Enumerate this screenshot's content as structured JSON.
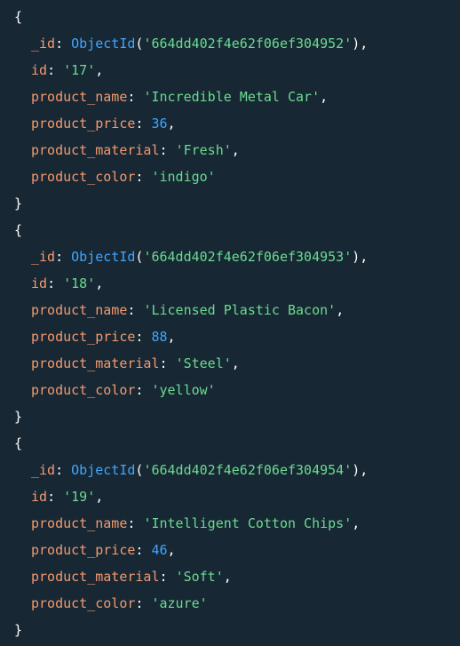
{
  "documents": [
    {
      "id_label": "_id",
      "objectid_fn": "ObjectId",
      "objectid_value": "'664dd402f4e62f06ef304952'",
      "fields": [
        {
          "key": "id",
          "value": "'17'",
          "type": "string"
        },
        {
          "key": "product_name",
          "value": "'Incredible Metal Car'",
          "type": "string"
        },
        {
          "key": "product_price",
          "value": "36",
          "type": "number"
        },
        {
          "key": "product_material",
          "value": "'Fresh'",
          "type": "string"
        },
        {
          "key": "product_color",
          "value": "'indigo'",
          "type": "string",
          "last": true
        }
      ]
    },
    {
      "id_label": "_id",
      "objectid_fn": "ObjectId",
      "objectid_value": "'664dd402f4e62f06ef304953'",
      "fields": [
        {
          "key": "id",
          "value": "'18'",
          "type": "string"
        },
        {
          "key": "product_name",
          "value": "'Licensed Plastic Bacon'",
          "type": "string"
        },
        {
          "key": "product_price",
          "value": "88",
          "type": "number"
        },
        {
          "key": "product_material",
          "value": "'Steel'",
          "type": "string"
        },
        {
          "key": "product_color",
          "value": "'yellow'",
          "type": "string",
          "last": true
        }
      ]
    },
    {
      "id_label": "_id",
      "objectid_fn": "ObjectId",
      "objectid_value": "'664dd402f4e62f06ef304954'",
      "fields": [
        {
          "key": "id",
          "value": "'19'",
          "type": "string"
        },
        {
          "key": "product_name",
          "value": "'Intelligent Cotton Chips'",
          "type": "string"
        },
        {
          "key": "product_price",
          "value": "46",
          "type": "number"
        },
        {
          "key": "product_material",
          "value": "'Soft'",
          "type": "string"
        },
        {
          "key": "product_color",
          "value": "'azure'",
          "type": "string",
          "last": true
        }
      ]
    }
  ],
  "theme": {
    "background": "#172734",
    "key_color": "#f39a6d",
    "string_color": "#6bdc8f",
    "number_color": "#3fa7ff",
    "punct_color": "#ffffff"
  }
}
